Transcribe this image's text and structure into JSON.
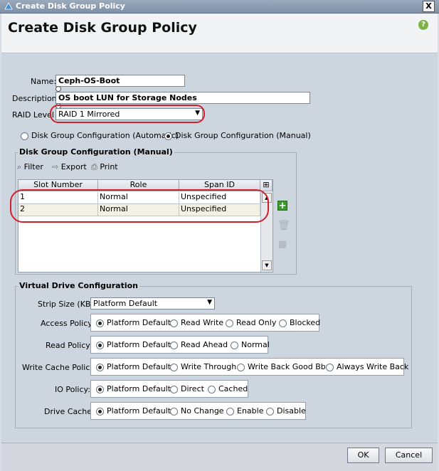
{
  "window": {
    "title": "Create Disk Group Policy",
    "close_glyph": "X"
  },
  "header": {
    "title": "Create Disk Group Policy",
    "help_glyph": "?"
  },
  "form": {
    "name_label": "Name:",
    "name_value": "Ceph-OS-Boot",
    "description_label": "Description:",
    "description_value": "OS boot LUN for Storage Nodes",
    "raid_label": "RAID Level",
    "raid_value": "RAID 1 Mirrored",
    "config_mode_options": [
      "Disk Group Configuration (Automatic)",
      "Disk Group Configuration (Manual)"
    ],
    "config_mode_selected": "Disk Group Configuration (Manual)"
  },
  "manual_config": {
    "legend": "Disk Group Configuration (Manual)",
    "toolbar": {
      "filter": "Filter",
      "export": "Export",
      "print": "Print"
    },
    "columns": [
      "Slot Number",
      "Role",
      "Span ID"
    ],
    "rows": [
      {
        "slot": "1",
        "role": "Normal",
        "span": "Unspecified"
      },
      {
        "slot": "2",
        "role": "Normal",
        "span": "Unspecified"
      }
    ]
  },
  "virtual_drive": {
    "legend": "Virtual Drive Configuration",
    "strip_size_label": "Strip Size (KB):",
    "strip_size_value": "Platform Default",
    "access_policy": {
      "label": "Access Policy:",
      "options": [
        "Platform Default",
        "Read Write",
        "Read Only",
        "Blocked"
      ],
      "selected": "Platform Default"
    },
    "read_policy": {
      "label": "Read Policy:",
      "options": [
        "Platform Default",
        "Read Ahead",
        "Normal"
      ],
      "selected": "Platform Default"
    },
    "write_cache_policy": {
      "label": "Write Cache Policy:",
      "options": [
        "Platform Default",
        "Write Through",
        "Write Back Good Bbu",
        "Always Write Back"
      ],
      "selected": "Platform Default"
    },
    "io_policy": {
      "label": "IO Policy:",
      "options": [
        "Platform Default",
        "Direct",
        "Cached"
      ],
      "selected": "Platform Default"
    },
    "drive_cache": {
      "label": "Drive Cache:",
      "options": [
        "Platform Default",
        "No Change",
        "Enable",
        "Disable"
      ],
      "selected": "Platform Default"
    }
  },
  "footer": {
    "ok_label": "OK",
    "cancel_label": "Cancel"
  },
  "colors": {
    "annotation_red": "#d0202a",
    "add_green": "#3a9a2a",
    "help_green": "#7cb342"
  }
}
